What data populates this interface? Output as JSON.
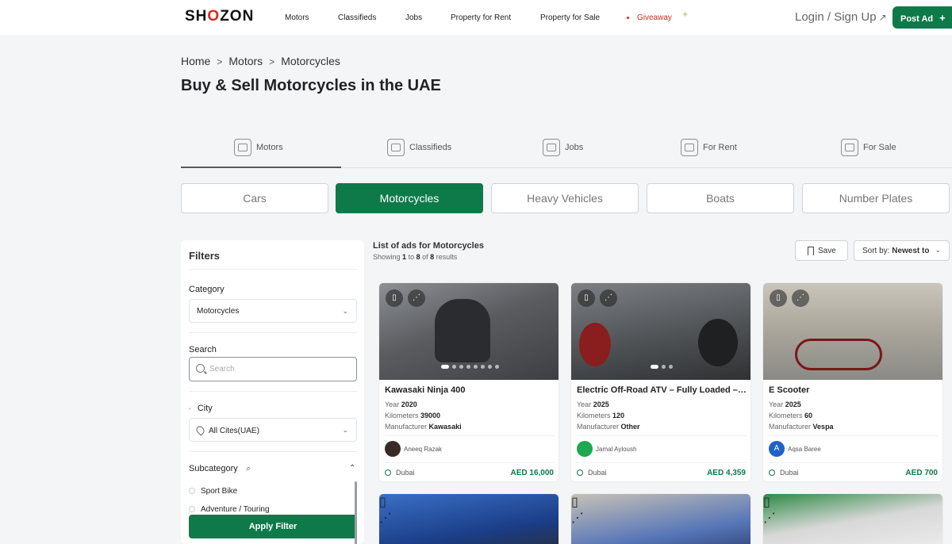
{
  "header": {
    "logo": "SHOZON",
    "nav": [
      "Motors",
      "Classifieds",
      "Jobs",
      "Property for Rent",
      "Property for Sale"
    ],
    "giveaway": "Giveaway",
    "login": "Login / Sign Up",
    "post_ad": "Post Ad"
  },
  "breadcrumb": [
    "Home",
    "Motors",
    "Motorcycles"
  ],
  "page_title": "Buy & Sell Motorcycles in the UAE",
  "category_tabs": [
    "Motors",
    "Classifieds",
    "Jobs",
    "For Rent",
    "For Sale"
  ],
  "sub_tabs": [
    "Cars",
    "Motorcycles",
    "Heavy Vehicles",
    "Boats",
    "Number Plates"
  ],
  "filters": {
    "title": "Filters",
    "category_label": "Category",
    "category_value": "Motorcycles",
    "search_label": "Search",
    "search_placeholder": "Search",
    "city_label": "City",
    "city_value": "All Cites(UAE)",
    "subcategory_label": "Subcategory",
    "subcategories": [
      "Sport Bike",
      "Adventure / Touring"
    ],
    "apply": "Apply Filter"
  },
  "results": {
    "title": "List of ads for Motorcycles",
    "showing_prefix": "Showing",
    "from": "1",
    "to_word": "to",
    "to": "8",
    "of_word": "of",
    "total": "8",
    "suffix": "results",
    "save": "Save",
    "sort_label": "Sort by:",
    "sort_value": "Newest to"
  },
  "listings": [
    {
      "title": "Kawasaki Ninja 400",
      "year_label": "Year",
      "year": "2020",
      "km_label": "Kilometers",
      "km": "39000",
      "mfr_label": "Manufacturer",
      "mfr": "Kawasaki",
      "seller": "Aneeq Razak",
      "avatar": "",
      "location": "Dubai",
      "price": "AED 16,000",
      "image_color": "#6b6d70"
    },
    {
      "title": "Electric Off-Road ATV – Fully Loaded – ...",
      "year_label": "Year",
      "year": "2025",
      "km_label": "Kilometers",
      "km": "120",
      "mfr_label": "Manufacturer",
      "mfr": "Other",
      "seller": "Jamal Ayloush",
      "avatar": "",
      "location": "Dubai",
      "price": "AED 4,359",
      "image_color": "#55585b"
    },
    {
      "title": "E Scooter",
      "year_label": "Year",
      "year": "2025",
      "km_label": "Kilometers",
      "km": "60",
      "mfr_label": "Manufacturer",
      "mfr": "Vespa",
      "seller": "Aqsa Baree",
      "avatar": "A",
      "location": "Dubai",
      "price": "AED 700",
      "image_color": "#a7a39a"
    }
  ]
}
